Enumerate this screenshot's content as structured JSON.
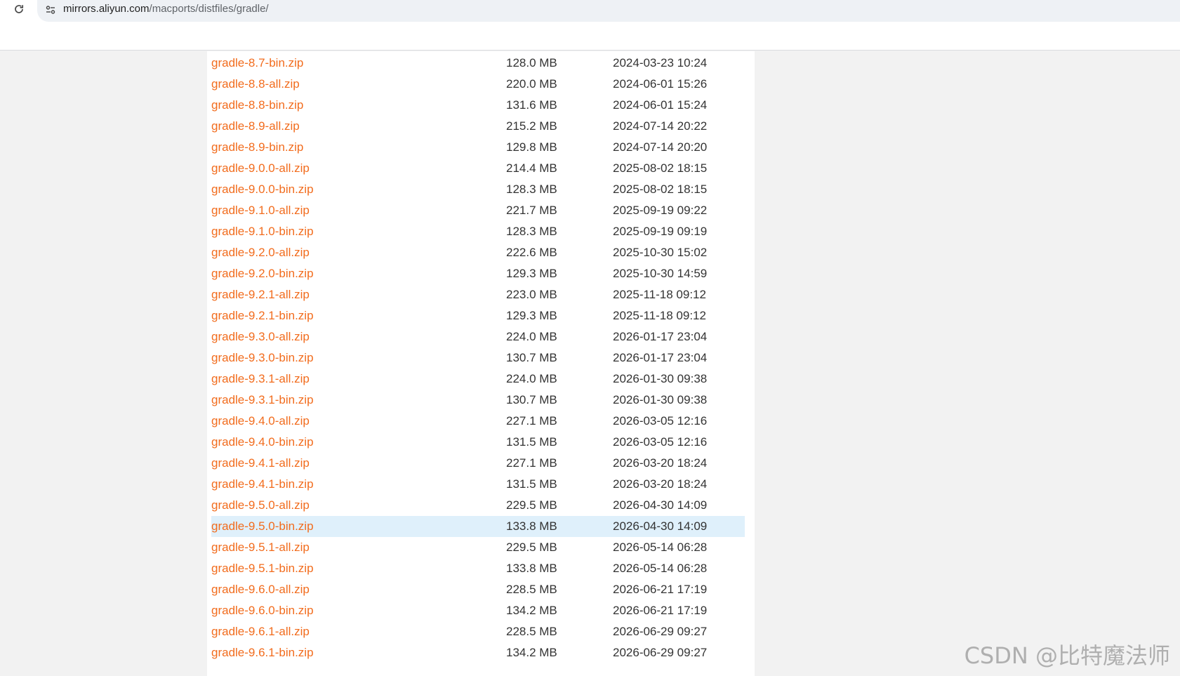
{
  "browser": {
    "url_host": "mirrors.aliyun.com",
    "url_path": "/macports/distfiles/gradle/",
    "reload_icon": "reload-icon",
    "site_info_icon": "tune-icon"
  },
  "highlight_row_index": 22,
  "colors": {
    "link": "#f26c1d",
    "highlight": "#dff0fb"
  },
  "files": [
    {
      "name": "gradle-8.7-bin.zip",
      "size": "128.0 MB",
      "date": "2024-03-23 10:24"
    },
    {
      "name": "gradle-8.8-all.zip",
      "size": "220.0 MB",
      "date": "2024-06-01 15:26"
    },
    {
      "name": "gradle-8.8-bin.zip",
      "size": "131.6 MB",
      "date": "2024-06-01 15:24"
    },
    {
      "name": "gradle-8.9-all.zip",
      "size": "215.2 MB",
      "date": "2024-07-14 20:22"
    },
    {
      "name": "gradle-8.9-bin.zip",
      "size": "129.8 MB",
      "date": "2024-07-14 20:20"
    },
    {
      "name": "gradle-9.0.0-all.zip",
      "size": "214.4 MB",
      "date": "2025-08-02 18:15"
    },
    {
      "name": "gradle-9.0.0-bin.zip",
      "size": "128.3 MB",
      "date": "2025-08-02 18:15"
    },
    {
      "name": "gradle-9.1.0-all.zip",
      "size": "221.7 MB",
      "date": "2025-09-19 09:22"
    },
    {
      "name": "gradle-9.1.0-bin.zip",
      "size": "128.3 MB",
      "date": "2025-09-19 09:19"
    },
    {
      "name": "gradle-9.2.0-all.zip",
      "size": "222.6 MB",
      "date": "2025-10-30 15:02"
    },
    {
      "name": "gradle-9.2.0-bin.zip",
      "size": "129.3 MB",
      "date": "2025-10-30 14:59"
    },
    {
      "name": "gradle-9.2.1-all.zip",
      "size": "223.0 MB",
      "date": "2025-11-18 09:12"
    },
    {
      "name": "gradle-9.2.1-bin.zip",
      "size": "129.3 MB",
      "date": "2025-11-18 09:12"
    },
    {
      "name": "gradle-9.3.0-all.zip",
      "size": "224.0 MB",
      "date": "2026-01-17 23:04"
    },
    {
      "name": "gradle-9.3.0-bin.zip",
      "size": "130.7 MB",
      "date": "2026-01-17 23:04"
    },
    {
      "name": "gradle-9.3.1-all.zip",
      "size": "224.0 MB",
      "date": "2026-01-30 09:38"
    },
    {
      "name": "gradle-9.3.1-bin.zip",
      "size": "130.7 MB",
      "date": "2026-01-30 09:38"
    },
    {
      "name": "gradle-9.4.0-all.zip",
      "size": "227.1 MB",
      "date": "2026-03-05 12:16"
    },
    {
      "name": "gradle-9.4.0-bin.zip",
      "size": "131.5 MB",
      "date": "2026-03-05 12:16"
    },
    {
      "name": "gradle-9.4.1-all.zip",
      "size": "227.1 MB",
      "date": "2026-03-20 18:24"
    },
    {
      "name": "gradle-9.4.1-bin.zip",
      "size": "131.5 MB",
      "date": "2026-03-20 18:24"
    },
    {
      "name": "gradle-9.5.0-all.zip",
      "size": "229.5 MB",
      "date": "2026-04-30 14:09"
    },
    {
      "name": "gradle-9.5.0-bin.zip",
      "size": "133.8 MB",
      "date": "2026-04-30 14:09"
    },
    {
      "name": "gradle-9.5.1-all.zip",
      "size": "229.5 MB",
      "date": "2026-05-14 06:28"
    },
    {
      "name": "gradle-9.5.1-bin.zip",
      "size": "133.8 MB",
      "date": "2026-05-14 06:28"
    },
    {
      "name": "gradle-9.6.0-all.zip",
      "size": "228.5 MB",
      "date": "2026-06-21 17:19"
    },
    {
      "name": "gradle-9.6.0-bin.zip",
      "size": "134.2 MB",
      "date": "2026-06-21 17:19"
    },
    {
      "name": "gradle-9.6.1-all.zip",
      "size": "228.5 MB",
      "date": "2026-06-29 09:27"
    },
    {
      "name": "gradle-9.6.1-bin.zip",
      "size": "134.2 MB",
      "date": "2026-06-29 09:27"
    }
  ],
  "watermark": "CSDN @比特魔法师"
}
